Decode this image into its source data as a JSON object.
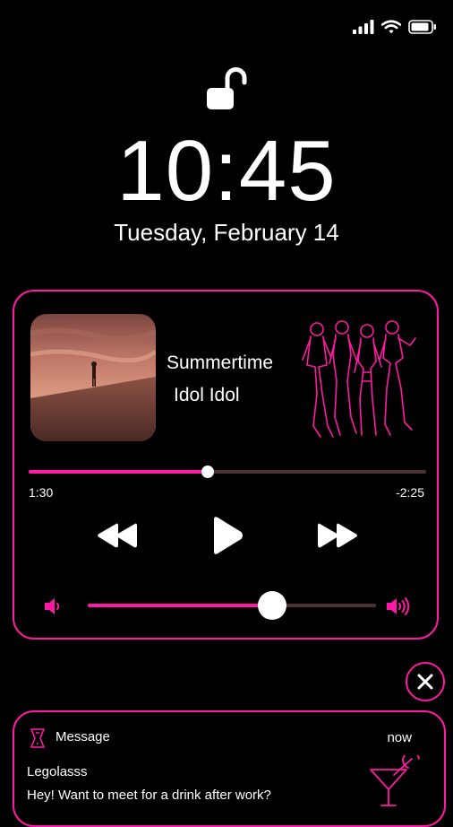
{
  "clock": {
    "time": "10:45",
    "date": "Tuesday, February 14"
  },
  "lock_state": "unlocked",
  "accent_color": "#ff1aa3",
  "now_playing": {
    "title": "Summertime",
    "artist": "Idol Idol",
    "elapsed": "1:30",
    "remaining": "-2:25",
    "progress_percent": 45,
    "volume_percent": 64
  },
  "icons": {
    "status": [
      "signal-bars-icon",
      "wifi-icon",
      "battery-icon"
    ],
    "controls": [
      "rewind-icon",
      "play-icon",
      "fast-forward-icon"
    ]
  },
  "notification": {
    "app": "Message",
    "time": "now",
    "sender": "Legolasss",
    "body": "Hey! Want to meet for a drink after work?"
  }
}
